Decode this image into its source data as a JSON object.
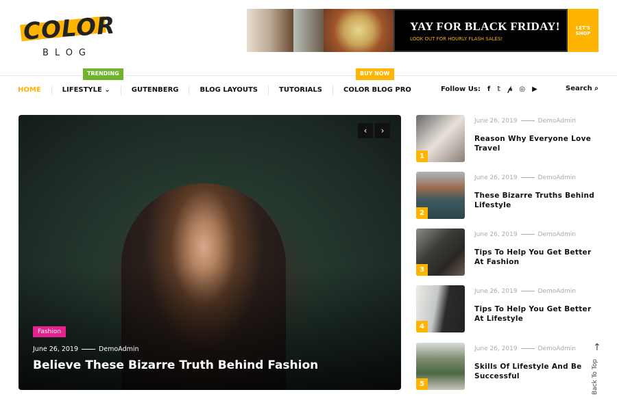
{
  "logo": {
    "word": "COLOR",
    "sub": "BLOG"
  },
  "banner": {
    "headline": "YAY FOR BLACK FRIDAY!",
    "subline": "LOOK OUT FOR HOURLY FLASH SALES!",
    "cta": "LET'S SHOP"
  },
  "nav": {
    "items": [
      "HOME",
      "LIFESTYLE",
      "GUTENBERG",
      "BLOG LAYOUTS",
      "TUTORIALS",
      "COLOR BLOG PRO"
    ],
    "trending": "TRENDING",
    "buy_now": "BUY NOW",
    "follow_label": "Follow Us:",
    "search_label": "Search"
  },
  "colors": {
    "accent": "#ffb400",
    "trending": "#6eb42c",
    "category": "#e3218f"
  },
  "hero": {
    "category": "Fashion",
    "date": "June 26, 2019",
    "author": "DemoAdmin",
    "title": "Believe These Bizarre Truth Behind Fashion"
  },
  "posts": [
    {
      "num": "1",
      "date": "June 26, 2019",
      "author": "DemoAdmin",
      "title": "Reason Why Everyone Love Travel"
    },
    {
      "num": "2",
      "date": "June 26, 2019",
      "author": "DemoAdmin",
      "title": "These Bizarre Truths Behind Lifestyle"
    },
    {
      "num": "3",
      "date": "June 26, 2019",
      "author": "DemoAdmin",
      "title": "Tips To Help You Get Better At Fashion"
    },
    {
      "num": "4",
      "date": "June 26, 2019",
      "author": "DemoAdmin",
      "title": "Tips To Help You Get Better At Lifestyle"
    },
    {
      "num": "5",
      "date": "June 26, 2019",
      "author": "DemoAdmin",
      "title": "Skills Of Lifestyle And Be Successful"
    }
  ],
  "back_to_top": "Back To Top"
}
